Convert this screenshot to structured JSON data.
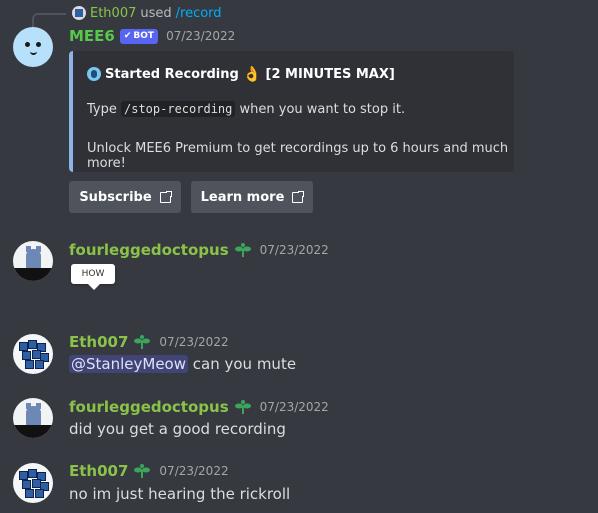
{
  "reply": {
    "user": "Eth007",
    "used": "used",
    "command": "/record"
  },
  "mee6": {
    "username": "MEE6",
    "bot_tag": "BOT",
    "timestamp": "07/23/2022",
    "embed": {
      "title": "Started Recording",
      "title_suffix": "[2 MINUTES MAX]",
      "desc_prefix": "Type",
      "desc_code": "/stop-recording",
      "desc_suffix": "when you want to stop it.",
      "desc2": "Unlock MEE6 Premium to get recordings up to 6 hours and much more!",
      "accent_color": "#8db4e8"
    },
    "buttons": [
      {
        "label": "Subscribe",
        "icon": "external-link-icon"
      },
      {
        "label": "Learn more",
        "icon": "external-link-icon"
      }
    ]
  },
  "messages": [
    {
      "username": "fourleggedoctopus",
      "timestamp": "07/23/2022",
      "sticker": "HOW"
    },
    {
      "username": "Eth007",
      "timestamp": "07/23/2022",
      "mention": "@StanleyMeow",
      "text": "can you mute"
    },
    {
      "username": "fourleggedoctopus",
      "timestamp": "07/23/2022",
      "text": "did you get a good recording"
    },
    {
      "username": "Eth007",
      "timestamp": "07/23/2022",
      "text": "no im just hearing the rickroll"
    }
  ],
  "colors": {
    "background": "#36393f",
    "username_green": "#57c84a",
    "bot_blurple": "#5865f2"
  }
}
